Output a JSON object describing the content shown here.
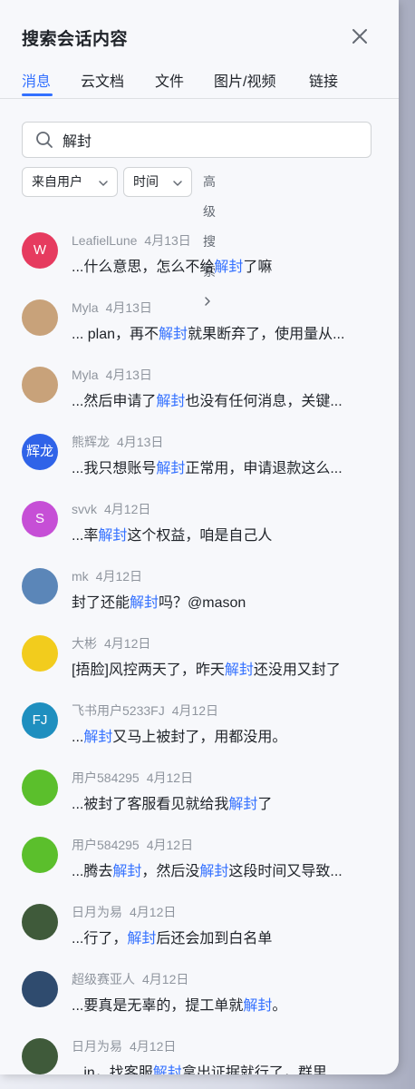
{
  "header": {
    "title": "搜索会话内容"
  },
  "tabs": [
    {
      "label": "消息"
    },
    {
      "label": "云文档"
    },
    {
      "label": "文件"
    },
    {
      "label": "图片/视频"
    },
    {
      "label": "链接"
    }
  ],
  "search": {
    "value": "解封"
  },
  "filters": {
    "from_user": "来自用户",
    "time": "时间",
    "advanced": "高级搜索"
  },
  "results": [
    {
      "name": "LeafielLune",
      "date": "4月13日",
      "avatar_text": "W",
      "avatar_color": "#e63b5f",
      "parts": [
        "...什么意思，怎么不给",
        "解封",
        "了嘛"
      ]
    },
    {
      "name": "Myla",
      "date": "4月13日",
      "avatar_text": "",
      "avatar_color": "#c8a27a",
      "parts": [
        "... plan，再不",
        "解封",
        "就果断弃了，使用量从..."
      ]
    },
    {
      "name": "Myla",
      "date": "4月13日",
      "avatar_text": "",
      "avatar_color": "#c8a27a",
      "parts": [
        "...然后申请了",
        "解封",
        "也没有任何消息，关键..."
      ]
    },
    {
      "name": "熊辉龙",
      "date": "4月13日",
      "avatar_text": "辉龙",
      "avatar_color": "#2f63e8",
      "parts": [
        "...我只想账号",
        "解封",
        "正常用，申请退款这么..."
      ]
    },
    {
      "name": "svvk",
      "date": "4月12日",
      "avatar_text": "S",
      "avatar_color": "#c64fd6",
      "parts": [
        "...率",
        "解封",
        "这个权益，咱是自己人"
      ]
    },
    {
      "name": "mk",
      "date": "4月12日",
      "avatar_text": "",
      "avatar_color": "#5b86b8",
      "parts": [
        "封了还能",
        "解封",
        "吗？@mason"
      ]
    },
    {
      "name": "大彬",
      "date": "4月12日",
      "avatar_text": "",
      "avatar_color": "#f2cc1d",
      "parts": [
        "[捂脸]风控两天了，昨天",
        "解封",
        "还没用又封了"
      ]
    },
    {
      "name": "飞书用户5233FJ",
      "date": "4月12日",
      "avatar_text": "FJ",
      "avatar_color": "#1f8fbf",
      "parts": [
        "...",
        "解封",
        "又马上被封了，用都没用。"
      ]
    },
    {
      "name": "用户584295",
      "date": "4月12日",
      "avatar_text": "",
      "avatar_color": "#5bbf2c",
      "parts": [
        "...被封了客服看见就给我",
        "解封",
        "了"
      ]
    },
    {
      "name": "用户584295",
      "date": "4月12日",
      "avatar_text": "",
      "avatar_color": "#5bbf2c",
      "parts": [
        "...腾去",
        "解封",
        "，然后没",
        "解封",
        "这段时间又导致..."
      ]
    },
    {
      "name": "日月为易",
      "date": "4月12日",
      "avatar_text": "",
      "avatar_color": "#3f5a3a",
      "parts": [
        "...行了，",
        "解封",
        "后还会加到白名单"
      ]
    },
    {
      "name": "超级赛亚人",
      "date": "4月12日",
      "avatar_text": "",
      "avatar_color": "#2f4b6e",
      "parts": [
        "...要真是无辜的，提工单就",
        "解封",
        "。"
      ]
    },
    {
      "name": "日月为易",
      "date": "4月12日",
      "avatar_text": "",
      "avatar_color": "#3f5a3a",
      "parts": [
        "...in，找客服",
        "解封",
        "拿出证据就行了，群里..."
      ]
    }
  ]
}
